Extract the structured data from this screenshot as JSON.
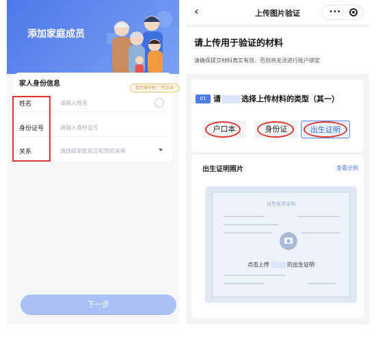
{
  "left": {
    "hero_title": "添加家庭成员",
    "card_title": "家人身份信息",
    "tip": "若您家中有“ ”可点击",
    "rows": [
      {
        "label": "姓名",
        "placeholder": "请输入姓名"
      },
      {
        "label": "身份证号",
        "placeholder": "请输入身份证号"
      },
      {
        "label": "关系",
        "placeholder": "请选择家庭成员和您的关系"
      }
    ],
    "next_label": "下一步"
  },
  "right": {
    "nav_title": "上传图片验证",
    "heading": "请上传用于验证的材料",
    "subtext": "请确保提交材料真实有效，否则将无法进行账户绑定",
    "step_badge": "01",
    "section_title_prefix": "请",
    "section_title_suffix": "选择上传材料的类型（其一）",
    "options": [
      "户口本",
      "身份证",
      "出生证明"
    ],
    "selected_option": "出生证明",
    "photo_title": "出生证明照片",
    "view_example": "查看示例",
    "certificate_heading": "出生医学证明",
    "upload_prefix": "点击上传",
    "upload_suffix": "的出生证明"
  },
  "colors": {
    "accent": "#4f7be8",
    "highlight": "#e0352b",
    "button_disabled": "#a9c1f5"
  }
}
